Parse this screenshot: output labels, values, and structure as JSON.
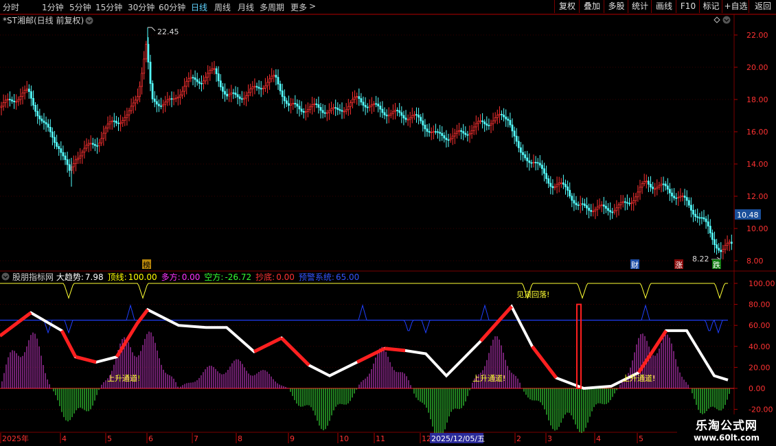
{
  "toolbar": {
    "periods": [
      {
        "label": "分时"
      },
      {
        "label": "1分钟"
      },
      {
        "label": "5分钟"
      },
      {
        "label": "15分钟"
      },
      {
        "label": "30分钟"
      },
      {
        "label": "60分钟"
      },
      {
        "label": "日线"
      },
      {
        "label": "周线"
      },
      {
        "label": "月线"
      },
      {
        "label": "多周期"
      },
      {
        "label": "更多"
      }
    ],
    "more_arrow": ">",
    "active_period": "日线",
    "right_buttons": [
      {
        "label": "复权"
      },
      {
        "label": "叠加"
      },
      {
        "label": "多股"
      },
      {
        "label": "统计"
      },
      {
        "label": "画线"
      },
      {
        "label": "F10"
      },
      {
        "label": "标记"
      },
      {
        "label": "+自选"
      },
      {
        "label": "返回"
      }
    ]
  },
  "price_panel": {
    "title": "*ST湘邮(日线 前复权)",
    "high_label": "22.45",
    "low_label": "8.22",
    "current_price": "10.48",
    "markers": {
      "m1": "榜",
      "m2": "财",
      "m3": "涨",
      "m4": "跌"
    },
    "y_ticks": [
      "22.00",
      "20.00",
      "18.00",
      "16.00",
      "14.00",
      "12.00",
      "10.00",
      "8.00"
    ]
  },
  "indicator_panel": {
    "name": "股朋指标网",
    "fields": [
      {
        "label": "大趋势:",
        "value": "7.98",
        "color": "#ffffff"
      },
      {
        "label": "顶线:",
        "value": "100.00",
        "color": "#ffff00"
      },
      {
        "label": "多方:",
        "value": "0.00",
        "color": "#ff33ff"
      },
      {
        "label": "空方:",
        "value": "-26.72",
        "color": "#33ff33"
      },
      {
        "label": "抄底:",
        "value": "0.00",
        "color": "#ff3333"
      },
      {
        "label": "预警系统:",
        "value": "65.00",
        "color": "#3355ff"
      }
    ],
    "annotations": {
      "a1": "上升通道!",
      "a2": "上升通道!",
      "a3": "上升通道!",
      "a4": "见顶回落!"
    },
    "y_ticks": [
      "100.00",
      "80.00",
      "60.00",
      "40.00",
      "20.00",
      "0.00",
      "-20.00"
    ]
  },
  "time_axis": {
    "labels": [
      "2025年",
      "4",
      "5",
      "6",
      "7",
      "8",
      "9",
      "10",
      "11",
      "12",
      "2",
      "3",
      "4",
      "5"
    ],
    "cursor_date": "2025/12/05/五"
  },
  "watermark": {
    "main": "乐淘公式网",
    "url": "www.60lt.com"
  },
  "colors": {
    "up": "#ff3232",
    "down": "#54ffff",
    "grid": "#7a0000",
    "axis_text": "#ff3232"
  }
}
